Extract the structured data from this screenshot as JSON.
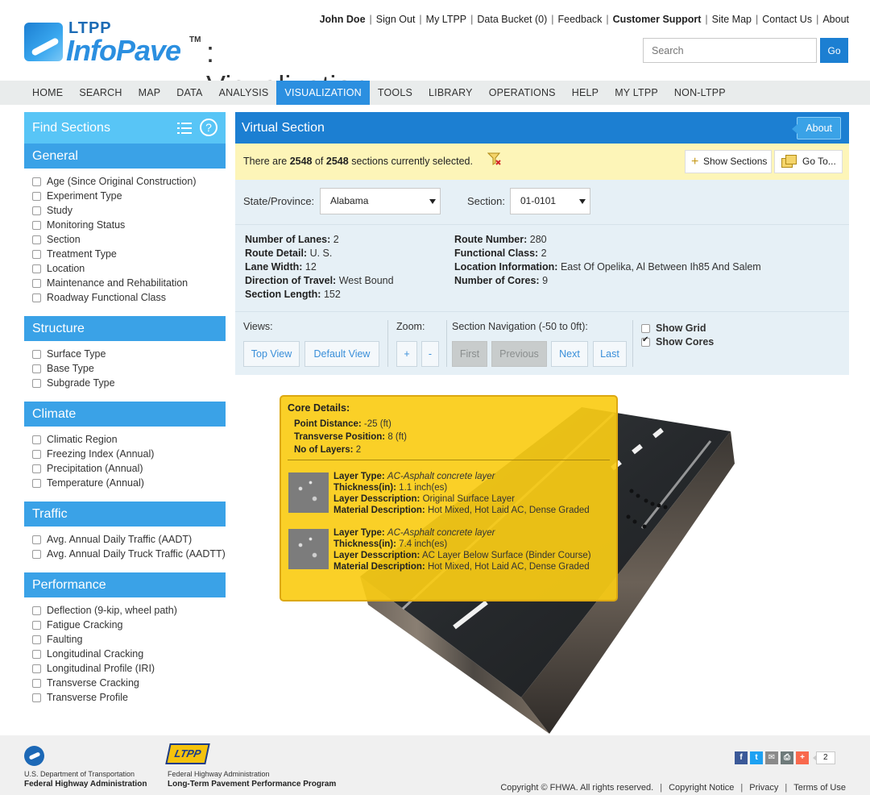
{
  "header": {
    "logo": {
      "ltpp": "LTPP",
      "infopave": "InfoPave",
      "tm": "TM",
      "page": ": Visualization"
    },
    "user_name": "John Doe",
    "links": [
      "Sign Out",
      "My LTPP",
      "Data Bucket (0)",
      "Feedback"
    ],
    "links_right": [
      "Site Map",
      "Contact Us",
      "About"
    ],
    "customer_support": "Customer Support",
    "search_placeholder": "Search",
    "search_go": "Go"
  },
  "nav": {
    "items": [
      "HOME",
      "SEARCH",
      "MAP",
      "DATA",
      "ANALYSIS",
      "VISUALIZATION",
      "TOOLS",
      "LIBRARY",
      "OPERATIONS",
      "HELP",
      "MY LTPP",
      "NON-LTPP"
    ],
    "active": "VISUALIZATION"
  },
  "sidebar": {
    "title": "Find Sections",
    "categories": [
      {
        "name": "General",
        "items": [
          "Age (Since Original Construction)",
          "Experiment Type",
          "Study",
          "Monitoring Status",
          "Section",
          "Treatment Type",
          "Location",
          "Maintenance and Rehabilitation",
          "Roadway Functional Class"
        ]
      },
      {
        "name": "Structure",
        "items": [
          "Surface Type",
          "Base Type",
          "Subgrade Type"
        ]
      },
      {
        "name": "Climate",
        "items": [
          "Climatic Region",
          "Freezing Index (Annual)",
          "Precipitation (Annual)",
          "Temperature (Annual)"
        ]
      },
      {
        "name": "Traffic",
        "items": [
          "Avg. Annual Daily Traffic (AADT)",
          "Avg. Annual Daily Truck Traffic (AADTT)"
        ]
      },
      {
        "name": "Performance",
        "items": [
          "Deflection (9-kip, wheel path)",
          "Fatigue Cracking",
          "Faulting",
          "Longitudinal Cracking",
          "Longitudinal Profile (IRI)",
          "Transverse Cracking",
          "Transverse Profile"
        ]
      }
    ]
  },
  "main": {
    "title": "Virtual Section",
    "about": "About",
    "selection": {
      "prefix": "There are",
      "selected": "2548",
      "of": "of",
      "total": "2548",
      "suffix": "sections currently selected."
    },
    "show_sections": "Show Sections",
    "goto": "Go To...",
    "state_label": "State/Province:",
    "state_value": "Alabama",
    "section_label": "Section:",
    "section_value": "01-0101",
    "info_left": [
      {
        "k": "Number of Lanes:",
        "v": "2"
      },
      {
        "k": "Route Detail:",
        "v": "U. S."
      },
      {
        "k": "Lane Width:",
        "v": "12"
      },
      {
        "k": "Direction of Travel:",
        "v": "West Bound"
      },
      {
        "k": "Section Length:",
        "v": "152"
      }
    ],
    "info_right": [
      {
        "k": "Route Number:",
        "v": "280"
      },
      {
        "k": "Functional Class:",
        "v": "2"
      },
      {
        "k": "Location Information:",
        "v": "East Of Opelika, Al Between Ih85 And Salem"
      },
      {
        "k": "Number of Cores:",
        "v": "9"
      }
    ],
    "controls": {
      "views_label": "Views:",
      "top_view": "Top View",
      "default_view": "Default View",
      "zoom_label": "Zoom:",
      "zoom_in": "+",
      "zoom_out": "-",
      "nav_label": "Section Navigation (-50 to 0ft):",
      "first": "First",
      "previous": "Previous",
      "next": "Next",
      "last": "Last",
      "show_grid": "Show Grid",
      "show_grid_checked": false,
      "show_cores": "Show Cores",
      "show_cores_checked": true
    }
  },
  "core_details": {
    "title": "Core Details:",
    "point_distance_label": "Point Distance:",
    "point_distance": "-25 (ft)",
    "transverse_label": "Transverse Position:",
    "transverse": "8 (ft)",
    "layers_label": "No of Layers:",
    "layers_count": "2",
    "layer_labels": {
      "type": "Layer Type:",
      "thickness": "Thickness(in):",
      "desc": "Layer Desscription:",
      "material": "Material Description:"
    },
    "layers": [
      {
        "type": "AC-Asphalt concrete layer",
        "thickness": "1.1 inch(es)",
        "desc": "Original Surface Layer",
        "material": "Hot Mixed, Hot Laid AC, Dense Graded"
      },
      {
        "type": "AC-Asphalt concrete layer",
        "thickness": "7.4 inch(es)",
        "desc": "AC Layer Below Surface (Binder Course)",
        "material": "Hot Mixed, Hot Laid AC, Dense Graded"
      }
    ]
  },
  "footer": {
    "dot_line1": "U.S. Department of Transportation",
    "dot_line2": "Federal Highway Administration",
    "ltpp_badge": "LTPP",
    "ltpp_line1": "Federal Highway Administration",
    "ltpp_line2": "Long-Term Pavement Performance Program",
    "share_count": "2",
    "share_icons": [
      "facebook-icon",
      "twitter-icon",
      "email-icon",
      "print-icon",
      "addthis-icon"
    ],
    "links": [
      "Copyright © FHWA. All rights reserved.",
      "Copyright Notice",
      "Privacy",
      "Terms of Use"
    ]
  },
  "colors": {
    "primary": "#1c7fd2",
    "accent": "#2b8fe0",
    "light": "#58c5f6",
    "tooltip": "#facc15",
    "selbar": "#fdf5b8"
  }
}
